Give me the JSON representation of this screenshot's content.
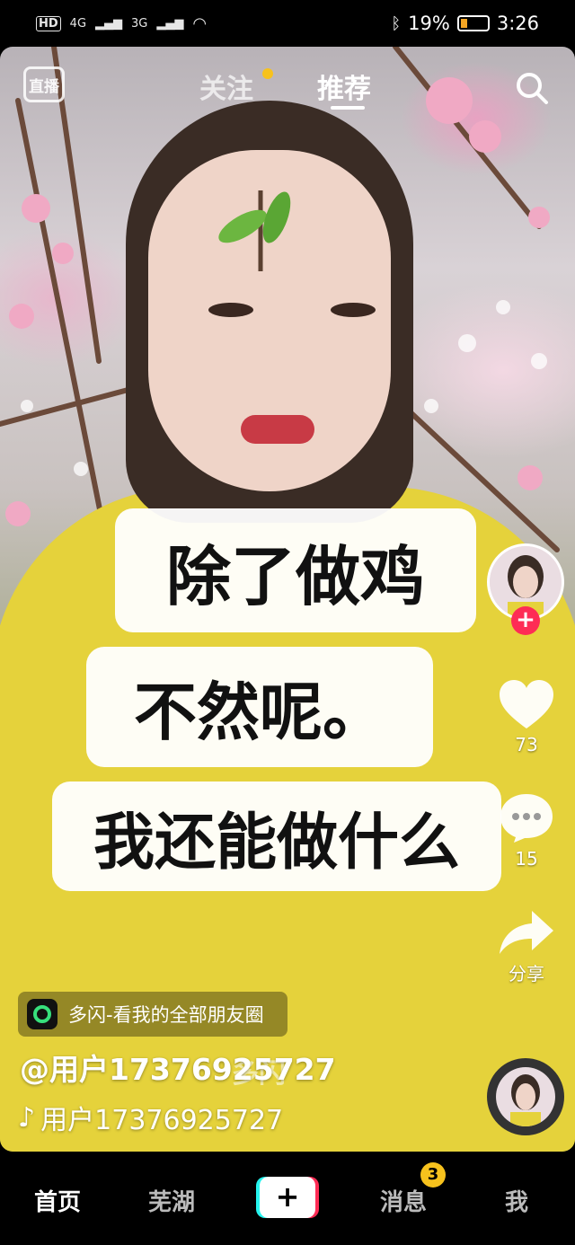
{
  "status_bar": {
    "network_left": "HD",
    "signal_4g": "4G",
    "signal_3g": "3G",
    "battery_percent": "19%",
    "time": "3:26"
  },
  "top_nav": {
    "live_label": "直播",
    "follow_tab": "关注",
    "recommend_tab": "推荐"
  },
  "captions": [
    "除了做鸡",
    "不然呢。",
    "我还能做什么"
  ],
  "actions": {
    "like_count": "73",
    "comment_count": "15",
    "share_label": "分享"
  },
  "music_chip": {
    "text": "多闪-看我的全部朋友圈"
  },
  "video_info": {
    "username": "@用户17376925727",
    "sound": "用户17376925727",
    "watermark": "多闪"
  },
  "bottom_nav": {
    "home": "首页",
    "city": "芜湖",
    "create": "+",
    "messages": "消息",
    "messages_badge": "3",
    "me": "我"
  },
  "colors": {
    "accent_red": "#fe2c55",
    "accent_cyan": "#25f4ee",
    "badge_yellow": "#f7c21d"
  }
}
